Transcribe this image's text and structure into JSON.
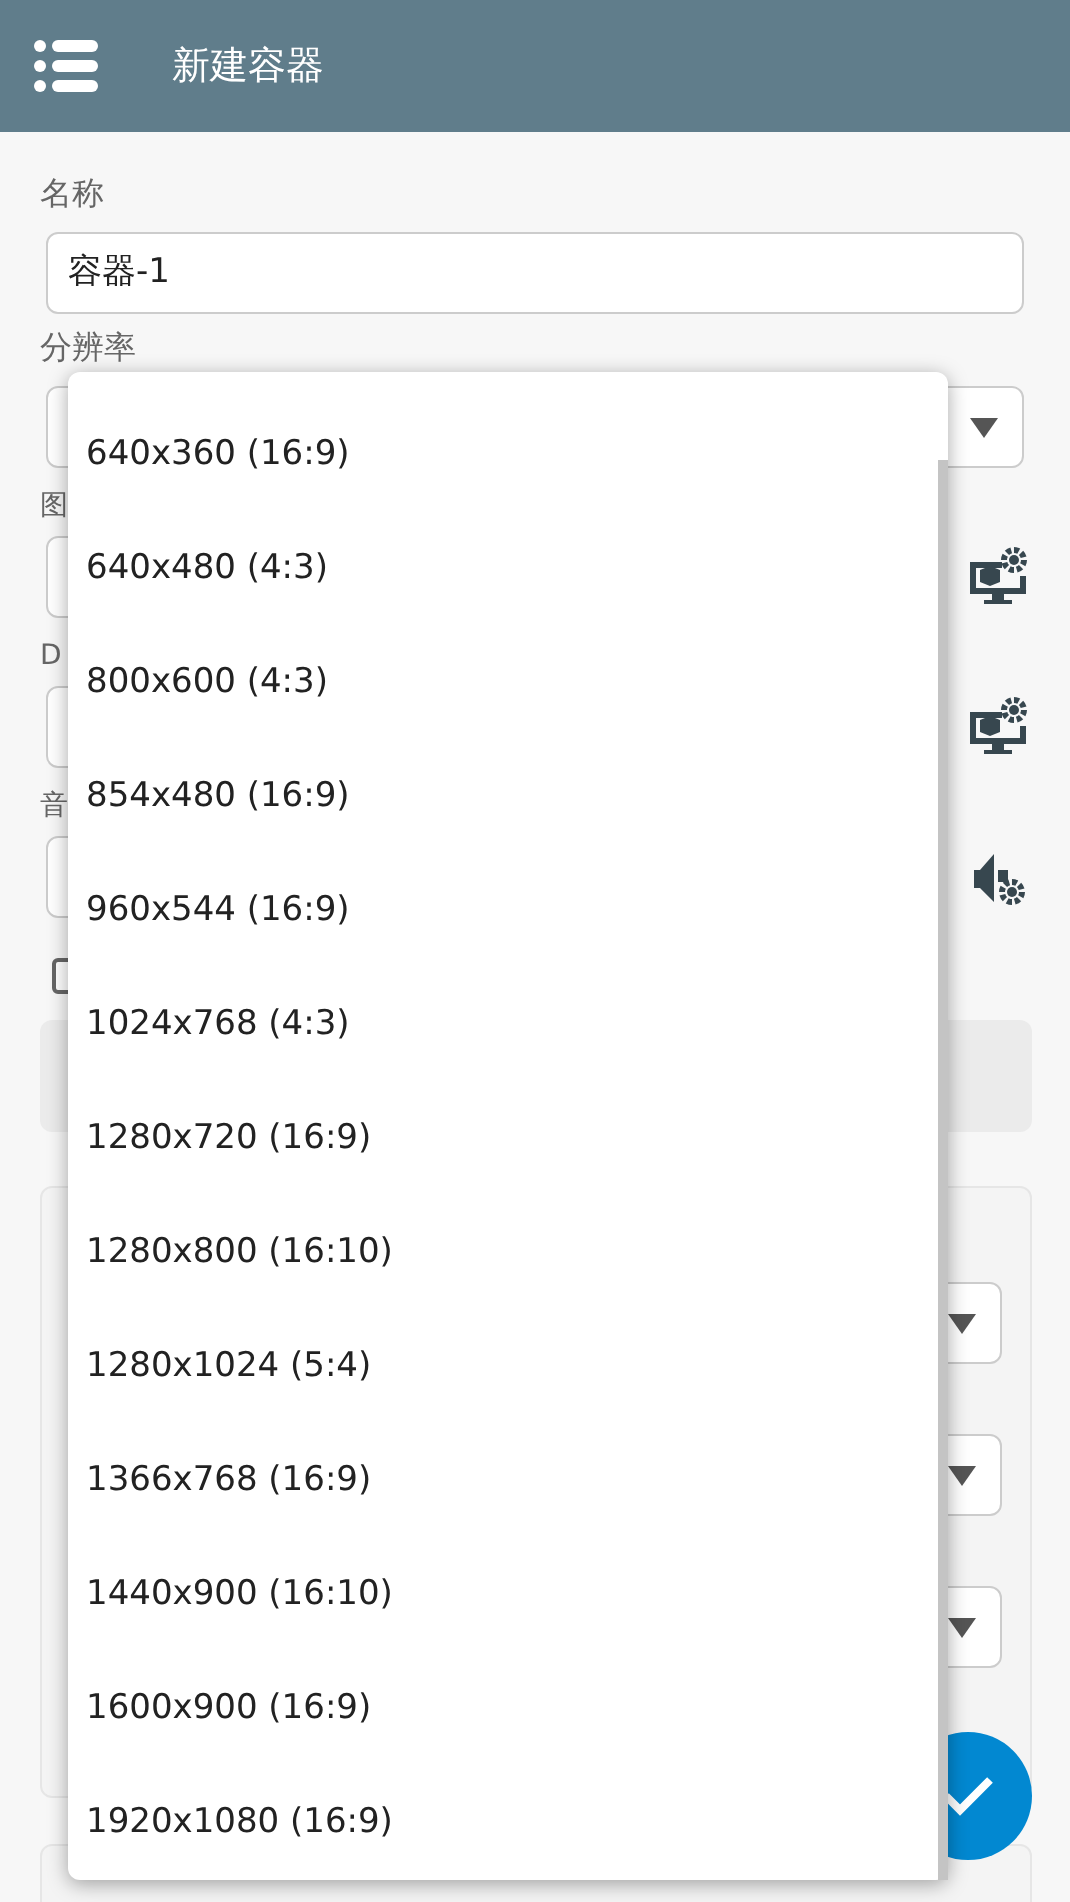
{
  "header": {
    "title": "新建容器"
  },
  "name_field": {
    "label": "名称",
    "value": "容器-1"
  },
  "resolution_field": {
    "label": "分辨率"
  },
  "hidden_fields": [
    {
      "label": "图",
      "kind": "display"
    },
    {
      "label": "D",
      "kind": "display"
    },
    {
      "label": "音",
      "kind": "audio"
    }
  ],
  "checkbox": {
    "checked": false
  },
  "dropdown": {
    "options": [
      "640x360 (16:9)",
      "640x480 (4:3)",
      "800x600 (4:3)",
      "854x480 (16:9)",
      "960x544 (16:9)",
      "1024x768 (4:3)",
      "1280x720 (16:9)",
      "1280x800 (16:10)",
      "1280x1024 (5:4)",
      "1366x768 (16:9)",
      "1440x900 (16:10)",
      "1600x900 (16:9)",
      "1920x1080 (16:9)"
    ]
  }
}
